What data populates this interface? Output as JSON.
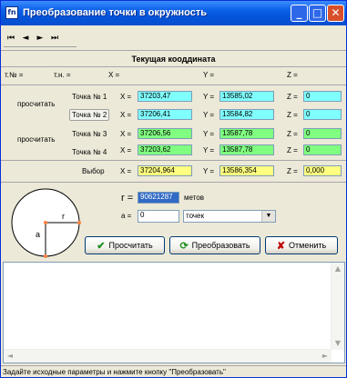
{
  "window": {
    "title": "Преобразование точки в окружность",
    "app_icon_text": "fn",
    "minimize_label": "_",
    "maximize_label": "□",
    "close_label": "✕"
  },
  "nav": {
    "first": "⏮",
    "prev": "◄",
    "next": "►",
    "last": "⏭"
  },
  "current": {
    "title": "Текущая кооддината",
    "tno_label": "т.№ =",
    "tn_label": "т.н. =",
    "x_label": "X =",
    "y_label": "Y =",
    "z_label": "Z ="
  },
  "calc_labels": {
    "first": "просчитать",
    "second": "просчитать"
  },
  "points": [
    {
      "label": "Точка № 1",
      "x": "37203,47",
      "y": "13585,02",
      "z": "0"
    },
    {
      "label": "Точка № 2",
      "x": "37206,41",
      "y": "13584,82",
      "z": "0"
    },
    {
      "label": "Точка № 3",
      "x": "37206,56",
      "y": "13587,78",
      "z": "0"
    },
    {
      "label": "Точка № 4",
      "x": "37203,62",
      "y": "13587,78",
      "z": "0"
    }
  ],
  "axis_labels": {
    "x": "X =",
    "y": "Y =",
    "z": "Z ="
  },
  "selection": {
    "label": "Выбор",
    "x": "37204,964",
    "y": "13586,354",
    "z": "0,000"
  },
  "params": {
    "r_label": "r =",
    "r_value": "90621287",
    "r_unit": "метов",
    "a_label": "a =",
    "a_value": "0",
    "a_unit": "точек",
    "diagram_r": "r",
    "diagram_a": "a"
  },
  "buttons": {
    "calc": "Просчитать",
    "transform": "Преобразовать",
    "cancel": "Отменить"
  },
  "status": {
    "text": "Задайте исходные параметры и нажмите кнопку \"Преобразовать\""
  },
  "colors": {
    "cyan": "#80ffff",
    "green": "#80ff80",
    "yellow": "#ffff80",
    "title_blue": "#0453d8"
  }
}
